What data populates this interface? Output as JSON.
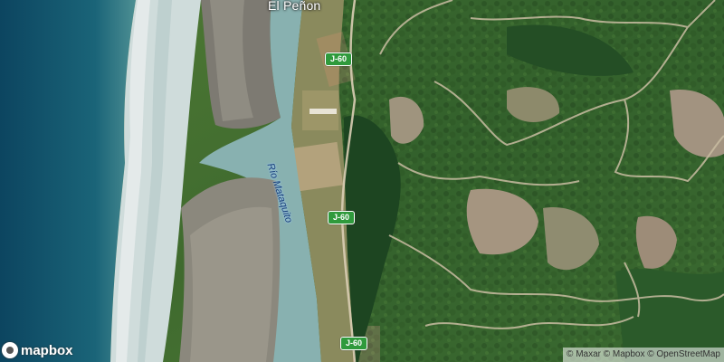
{
  "map": {
    "place_label": "El Peñon",
    "river_label": "Río Mataquito",
    "road_shields": [
      "J-60",
      "J-60",
      "J-60"
    ],
    "logo_text": "mapbox",
    "attribution": "© Maxar © Mapbox © OpenStreetMap",
    "colors": {
      "ocean_deep": "#0f4e66",
      "ocean_shallow": "#2a7686",
      "surf": "#dfe7e7",
      "sand": "#8d8a7f",
      "tidal_water": "#7aa7a8",
      "vegetation_dark": "#1f4a25",
      "vegetation_light": "#5b8a3c",
      "clearing": "#a89b7e",
      "road_shield": "#2f9a3c"
    }
  }
}
